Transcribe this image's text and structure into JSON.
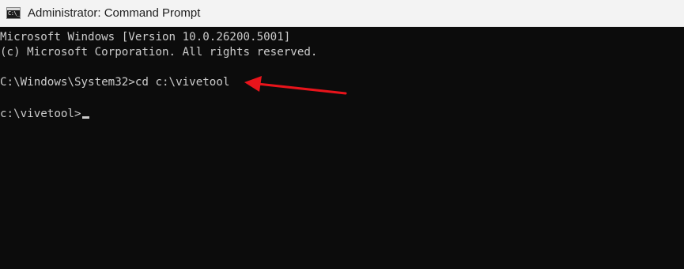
{
  "window": {
    "title": "Administrator: Command Prompt",
    "app_icon_label": "C:\\_"
  },
  "console": {
    "lines": [
      "Microsoft Windows [Version 10.0.26200.5001]",
      "(c) Microsoft Corporation. All rights reserved.",
      "",
      "C:\\Windows\\System32>cd c:\\vivetool",
      "",
      "c:\\vivetool>"
    ],
    "text_color": "#cccccc",
    "background_color": "#0c0c0c"
  },
  "annotation": {
    "arrow_color": "#e8141b"
  }
}
